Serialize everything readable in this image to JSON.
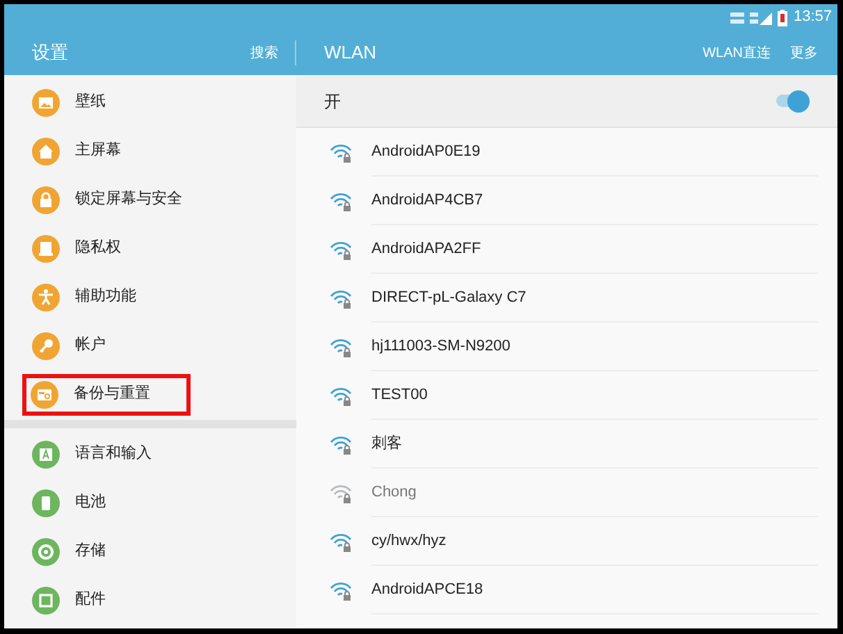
{
  "status_bar": {
    "time": "13:57"
  },
  "header": {
    "title": "设置",
    "search": "搜索",
    "panel_title": "WLAN",
    "actions": [
      "WLAN直连",
      "更多"
    ]
  },
  "sidebar": {
    "items": [
      {
        "label": "壁纸",
        "color": "#f0a533",
        "outlined": false
      },
      {
        "label": "主屏幕",
        "color": "#f0a533",
        "outlined": false
      },
      {
        "label": "锁定屏幕与安全",
        "color": "#f0a533",
        "outlined": false
      },
      {
        "label": "隐私权",
        "color": "#f0a533",
        "outlined": false
      },
      {
        "label": "辅助功能",
        "color": "#f0a533",
        "outlined": false
      },
      {
        "label": "帐户",
        "color": "#f0a533",
        "outlined": false
      },
      {
        "label": "备份与重置",
        "color": "#f0a533",
        "outlined": true
      },
      {
        "label": "语言和输入",
        "color": "#6db55e",
        "outlined": false
      },
      {
        "label": "电池",
        "color": "#6db55e",
        "outlined": false
      },
      {
        "label": "存储",
        "color": "#6db55e",
        "outlined": false
      },
      {
        "label": "配件",
        "color": "#6db55e",
        "outlined": false
      }
    ]
  },
  "wlan": {
    "switch": {
      "label": "开",
      "on": true
    },
    "networks": [
      {
        "name": "AndroidAP0E19",
        "dimmed": false
      },
      {
        "name": "AndroidAP4CB7",
        "dimmed": false
      },
      {
        "name": "AndroidAPA2FF",
        "dimmed": false
      },
      {
        "name": "DIRECT-pL-Galaxy C7",
        "dimmed": false
      },
      {
        "name": "hj111003-SM-N9200",
        "dimmed": false
      },
      {
        "name": "TEST00",
        "dimmed": false
      },
      {
        "name": "刺客",
        "dimmed": false
      },
      {
        "name": "Chong",
        "dimmed": true
      },
      {
        "name": "cy/hwx/hyz",
        "dimmed": false
      },
      {
        "name": "AndroidAPCE18",
        "dimmed": false
      }
    ]
  }
}
